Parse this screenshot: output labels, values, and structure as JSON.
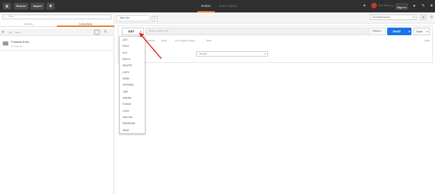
{
  "topbar": {
    "runner": "Runner",
    "import": "Import",
    "tab_builder": "Builder",
    "tab_team": "Team Library",
    "user_name": "Your name",
    "sign_in": "Sign In"
  },
  "sidebar": {
    "filter_placeholder": "Filter",
    "tab_history": "History",
    "tab_collections": "Collections",
    "team_row": "Team",
    "collection": {
      "name": "Postman Echo",
      "count": "37 requests"
    }
  },
  "main": {
    "tab_name": "New Tab",
    "environment": "No Environment",
    "method": "GET",
    "url_placeholder": "Enter request URL",
    "params": "Params",
    "send": "Send",
    "save": "Save",
    "subtabs": [
      "Headers",
      "Body",
      "Pre-request Script",
      "Tests"
    ],
    "code": "Code",
    "auth": "No Auth"
  },
  "methods": [
    "GET",
    "POST",
    "PUT",
    "PATCH",
    "DELETE",
    "COPY",
    "HEAD",
    "OPTIONS",
    "LINK",
    "UNLINK",
    "PURGE",
    "LOCK",
    "UNLOCK",
    "PROPFIND",
    "VIEW"
  ],
  "colors": {
    "accent": "#f47023",
    "send": "#1a74e8",
    "arrow": "#e0201a",
    "topbar": "#2f2f2f"
  }
}
